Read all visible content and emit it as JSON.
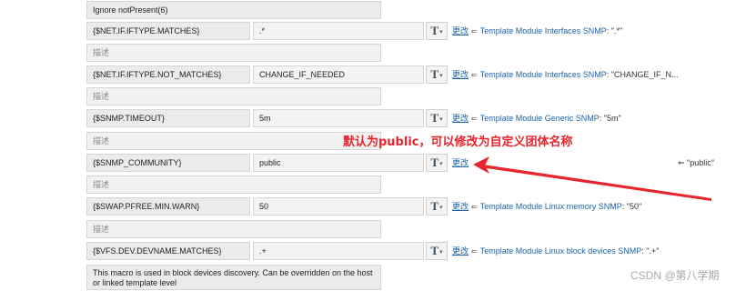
{
  "top_field": "Ignore notPresent(6)",
  "change_label": "更改",
  "description_placeholder": "描述",
  "rows": [
    {
      "macro": "{$NET.IF.IFTYPE.MATCHES}",
      "value": ".*",
      "template": "Template Module Interfaces SNMP",
      "inherited": ": \".*\""
    },
    {
      "macro": "{$NET.IF.IFTYPE.NOT_MATCHES}",
      "value": "CHANGE_IF_NEEDED",
      "template": "Template Module Interfaces SNMP",
      "inherited": ": \"CHANGE_IF_N..."
    },
    {
      "macro": "{$SNMP.TIMEOUT}",
      "value": "5m",
      "template": "Template Module Generic SNMP",
      "inherited": ": \"5m\""
    },
    {
      "macro": "{$SNMP_COMMUNITY}",
      "value": "public",
      "inherited": "\"public\""
    },
    {
      "macro": "{$SWAP.PFREE.MIN.WARN}",
      "value": "50",
      "template": "Template Module Linux memory SNMP",
      "inherited": ": \"50\""
    },
    {
      "macro": "{$VFS.DEV.DEVNAME.MATCHES}",
      "value": ".+",
      "template": "Template Module Linux block devices SNMP",
      "inherited": ": \".+\""
    }
  ],
  "last_description": "This macro is used in block devices discovery. Can be overridden on the host or linked template level",
  "annotation": "默认为public，可以修改为自定义团体名称",
  "watermark": "CSDN @第八学期",
  "colors": {
    "link": "#1a63a8",
    "annotation": "#e8242c",
    "field_bg": "#ebebeb"
  }
}
